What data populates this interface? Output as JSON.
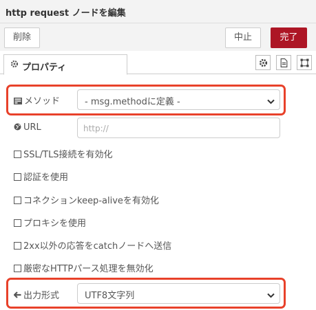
{
  "title": "http request ノードを編集",
  "buttons": {
    "delete": "削除",
    "cancel": "中止",
    "done": "完了"
  },
  "tab": {
    "label": "プロパティ"
  },
  "method": {
    "label": "メソッド",
    "value": "- msg.methodに定義 -"
  },
  "url": {
    "label": "URL",
    "placeholder": "http://",
    "value": ""
  },
  "options": [
    {
      "label": "SSL/TLS接続を有効化",
      "checked": false
    },
    {
      "label": "認証を使用",
      "checked": false
    },
    {
      "label": "コネクションkeep-aliveを有効化",
      "checked": false
    },
    {
      "label": "プロキシを使用",
      "checked": false
    },
    {
      "label": "2xx以外の応答をcatchノードへ送信",
      "checked": false
    },
    {
      "label": "厳密なHTTPパース処理を無効化",
      "checked": false
    }
  ],
  "return": {
    "label": "出力形式",
    "value": "UTF8文字列"
  },
  "colors": {
    "primary": "#ad1625",
    "highlight": "#e8412a"
  }
}
